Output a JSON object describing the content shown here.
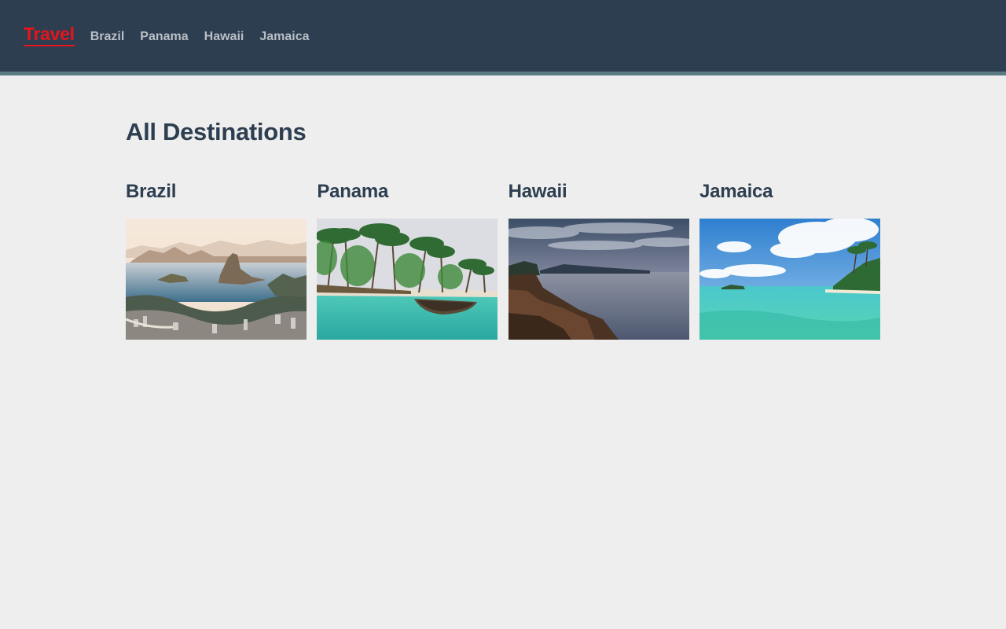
{
  "nav": {
    "brand": "Travel",
    "links": [
      "Brazil",
      "Panama",
      "Hawaii",
      "Jamaica"
    ]
  },
  "main": {
    "title": "All Destinations",
    "destinations": [
      {
        "name": "Brazil",
        "image_icon": "rio-bay-photo"
      },
      {
        "name": "Panama",
        "image_icon": "palm-beach-canoe-photo"
      },
      {
        "name": "Hawaii",
        "image_icon": "rocky-coast-sunset-photo"
      },
      {
        "name": "Jamaica",
        "image_icon": "tropical-lagoon-photo"
      }
    ]
  },
  "colors": {
    "nav_bg": "#2d3e50",
    "brand": "#e8141b",
    "nav_link": "#b9bfc6",
    "heading": "#2d3e50",
    "page_bg": "#eeeeee"
  }
}
